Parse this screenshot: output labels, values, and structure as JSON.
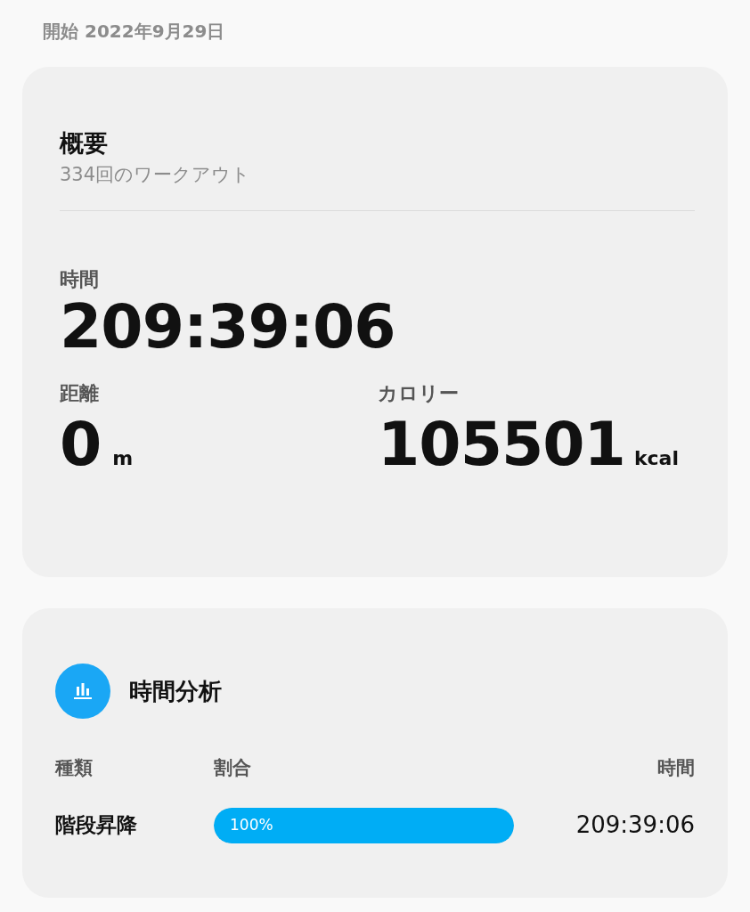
{
  "start_date": "開始 2022年9月29日",
  "summary": {
    "title": "概要",
    "subtitle": "334回のワークアウト",
    "duration": {
      "label": "時間",
      "value": "209:39:06"
    },
    "distance": {
      "label": "距離",
      "value": "0",
      "unit": "m"
    },
    "calories": {
      "label": "カロリー",
      "value": "105501",
      "unit": "kcal"
    }
  },
  "time_analysis": {
    "title": "時間分析",
    "columns": [
      "種類",
      "割合",
      "時間"
    ],
    "rows": [
      {
        "type": "階段昇降",
        "percent": "100%",
        "level": 1,
        "time": "209:39:06"
      }
    ]
  }
}
